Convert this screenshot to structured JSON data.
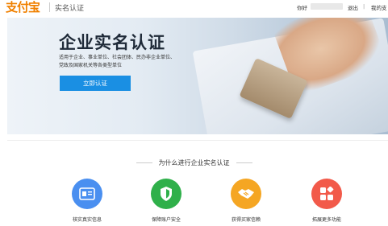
{
  "header": {
    "logo": "支付宝",
    "page_name": "实名认证",
    "greeting": "你好",
    "logout": "退出",
    "separator": "|",
    "my_account": "我的支"
  },
  "banner": {
    "title": "企业实名认证",
    "desc_line1": "适用于企业、事业单位、社会团体、民办非企业单位、",
    "desc_line2": "党政及国家机关等各类型单位",
    "cta": "立即认证"
  },
  "section": {
    "title": "为什么进行企业实名认证"
  },
  "features": [
    {
      "label": "核实真实信息",
      "icon": "id-card-icon",
      "color": "#4a8ff0"
    },
    {
      "label": "保障账户安全",
      "icon": "shield-icon",
      "color": "#2fb04a"
    },
    {
      "label": "获得买家信赖",
      "icon": "handshake-icon",
      "color": "#f5a623"
    },
    {
      "label": "拓展更多功能",
      "icon": "grid-icon",
      "color": "#f25a4a"
    }
  ],
  "colors": {
    "brand": "#f08000",
    "cta": "#1a8fe3"
  }
}
